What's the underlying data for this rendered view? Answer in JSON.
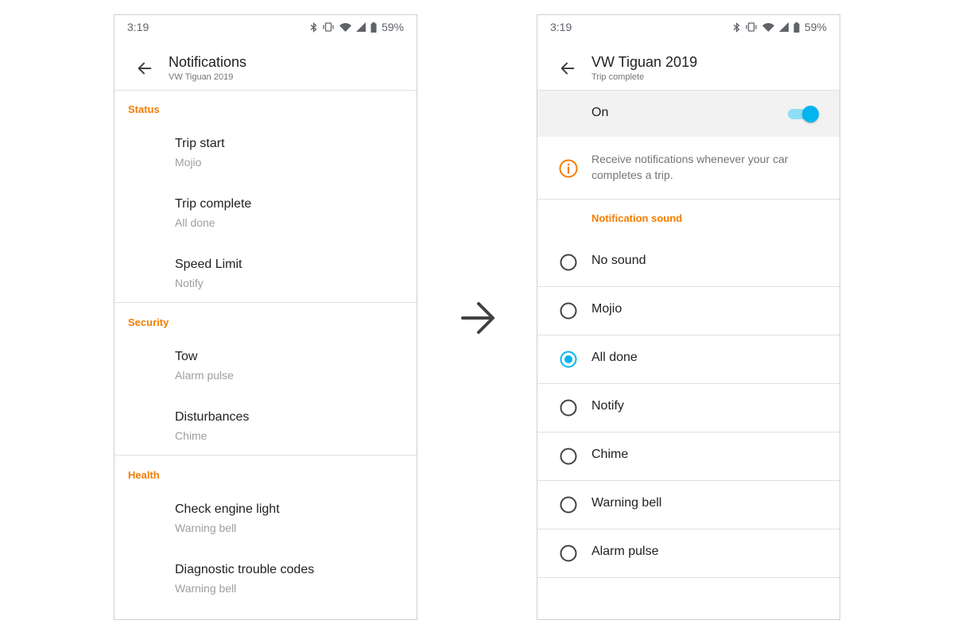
{
  "status_bar": {
    "time": "3:19",
    "battery": "59%"
  },
  "left_screen": {
    "title": "Notifications",
    "subtitle": "VW Tiguan 2019",
    "sections": [
      {
        "header": "Status",
        "items": [
          {
            "title": "Trip start",
            "subtitle": "Mojio"
          },
          {
            "title": "Trip complete",
            "subtitle": "All done"
          },
          {
            "title": "Speed Limit",
            "subtitle": "Notify"
          }
        ]
      },
      {
        "header": "Security",
        "items": [
          {
            "title": "Tow",
            "subtitle": "Alarm pulse"
          },
          {
            "title": "Disturbances",
            "subtitle": "Chime"
          }
        ]
      },
      {
        "header": "Health",
        "items": [
          {
            "title": "Check engine light",
            "subtitle": "Warning bell"
          },
          {
            "title": "Diagnostic trouble codes",
            "subtitle": "Warning bell"
          }
        ]
      }
    ]
  },
  "right_screen": {
    "title": "VW Tiguan 2019",
    "subtitle": "Trip complete",
    "toggle": {
      "label": "On",
      "checked": true
    },
    "info_text": "Receive notifications whenever your car completes a trip.",
    "sound_section_header": "Notification sound",
    "sounds": [
      {
        "label": "No sound",
        "selected": false
      },
      {
        "label": "Mojio",
        "selected": false
      },
      {
        "label": "All done",
        "selected": true
      },
      {
        "label": "Notify",
        "selected": false
      },
      {
        "label": "Chime",
        "selected": false
      },
      {
        "label": "Warning bell",
        "selected": false
      },
      {
        "label": "Alarm pulse",
        "selected": false
      }
    ]
  },
  "colors": {
    "section_header": "#f57c00",
    "accent": "#03b5ef",
    "toggle_track": "#8edff6",
    "info_icon": "#f57c00"
  },
  "icons": {
    "back": "arrow-left-icon",
    "transition": "arrow-right-icon",
    "info": "info-circle-icon",
    "status": [
      "bluetooth-icon",
      "vibrate-icon",
      "wifi-icon",
      "signal-icon",
      "battery-icon"
    ]
  }
}
